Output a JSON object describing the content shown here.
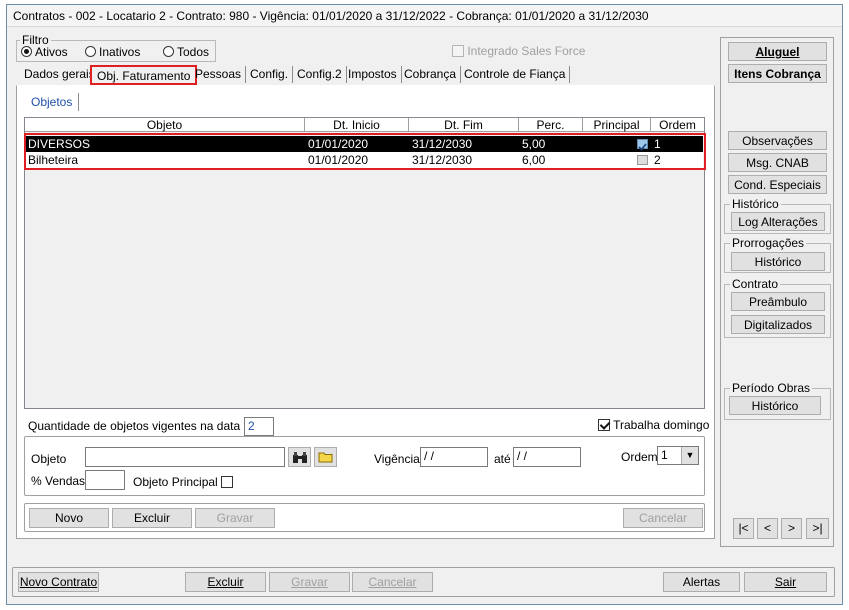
{
  "window": {
    "title": "Contratos - 002 - Locatario 2 - Contrato: 980 - Vigência: 01/01/2020 a 31/12/2022 - Cobrança: 01/01/2020 a 31/12/2030"
  },
  "filter": {
    "label": "Filtro",
    "options": [
      {
        "label": "Ativos",
        "selected": true
      },
      {
        "label": "Inativos",
        "selected": false
      },
      {
        "label": "Todos",
        "selected": false
      }
    ],
    "integrado_label": "Integrado Sales Force"
  },
  "tabs": [
    "Dados gerais",
    "Obj. Faturamento",
    "Pessoas",
    "Config.",
    "Config.2",
    "Impostos",
    "Cobrança",
    "Controle de Fiança"
  ],
  "subtab": "Objetos",
  "grid": {
    "columns": [
      "Objeto",
      "Dt. Inicio",
      "Dt. Fim",
      "Perc.",
      "Principal",
      "Ordem"
    ],
    "rows": [
      {
        "objeto": "DIVERSOS",
        "dt_inicio": "01/01/2020",
        "dt_fim": "31/12/2030",
        "perc": "5,00",
        "principal": true,
        "ordem": "1"
      },
      {
        "objeto": "Bilheteira",
        "dt_inicio": "01/01/2020",
        "dt_fim": "31/12/2030",
        "perc": "6,00",
        "principal": false,
        "ordem": "2"
      }
    ]
  },
  "qty": {
    "label": "Quantidade de objetos vigentes na data atual",
    "value": "2"
  },
  "trabalha_domingo": {
    "label": "Trabalha domingo",
    "checked": true
  },
  "form": {
    "objeto_label": "Objeto",
    "vigencia_label": "Vigência",
    "vig_start": " / /",
    "ate_label": "até",
    "vig_end": " / /",
    "ordem_label": "Ordem",
    "ordem_value": "1",
    "vendas_label": "% Vendas",
    "objeto_principal_label": "Objeto Principal"
  },
  "inner_buttons": {
    "novo": "Novo",
    "excluir": "Excluir",
    "gravar": "Gravar",
    "cancelar": "Cancelar"
  },
  "right_panel": {
    "aluguel": "Aluguel",
    "itens_cobranca": "Itens Cobrança",
    "observacoes": "Observações",
    "msg_cnab": "Msg. CNAB",
    "cond_especiais": "Cond. Especiais",
    "historico_label": "Histórico",
    "log_alteracoes": "Log Alterações",
    "prorrogacoes_label": "Prorrogações",
    "historico_btn": "Histórico",
    "contrato_label": "Contrato",
    "preambulo": "Preâmbulo",
    "digitalizados": "Digitalizados",
    "periodo_obras_label": "Período Obras",
    "historico_obras": "Histórico"
  },
  "nav": {
    "first": "|<",
    "prev": "<",
    "next": ">",
    "last": ">|"
  },
  "bottom": {
    "novo_contrato": "Novo Contrato",
    "excluir": "Excluir",
    "gravar": "Gravar",
    "cancelar": "Cancelar",
    "alertas": "Alertas",
    "sair": "Sair"
  },
  "colors": {
    "highlight": "#e02020",
    "selected_row": "#000000"
  }
}
